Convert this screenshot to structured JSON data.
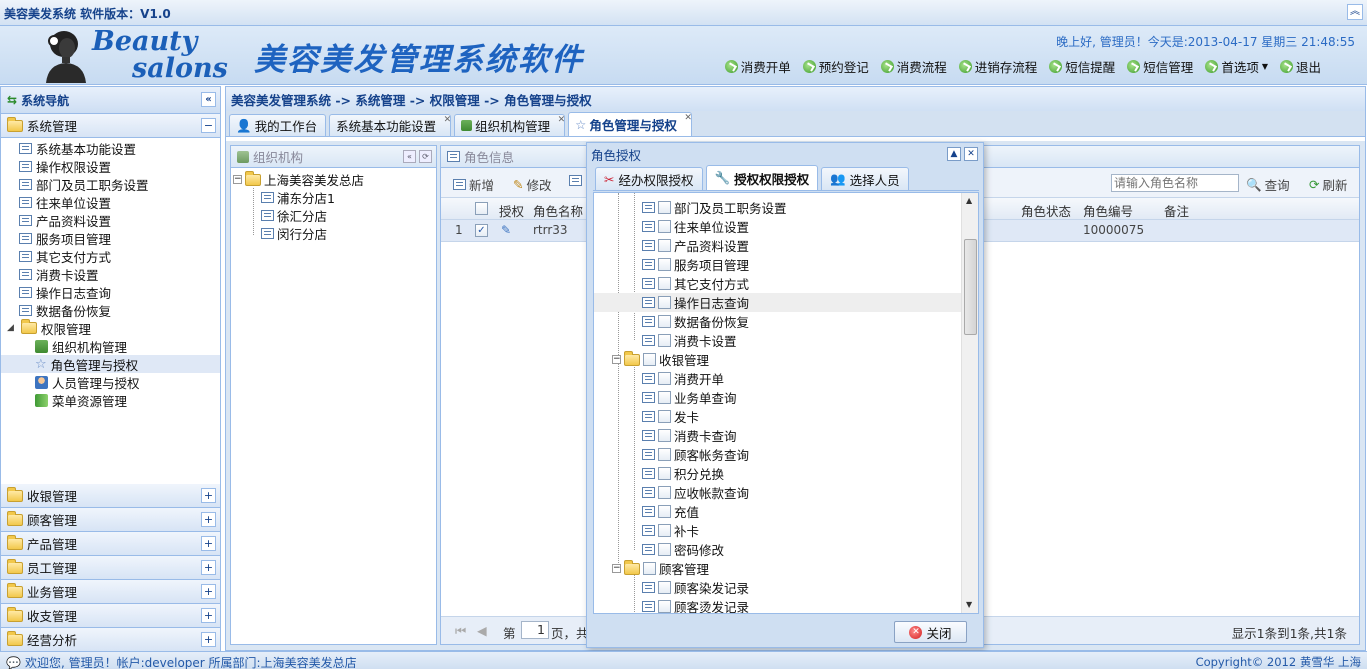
{
  "app": {
    "title": "美容美发系统 软件版本：V1.0",
    "logo_line1": "Beauty",
    "logo_line2": "salons",
    "banner_title": "美容美发管理系统软件"
  },
  "header": {
    "greeting": "晚上好, 管理员！今天是:2013-04-17 星期三 21:48:55",
    "nav": [
      "消费开单",
      "预约登记",
      "消费流程",
      "进销存流程",
      "短信提醒",
      "短信管理",
      "首选项",
      "退出"
    ],
    "nav_icon": "green-refresh-icon"
  },
  "sidebar": {
    "title": "系统导航",
    "open_section": "系统管理",
    "items": [
      "系统基本功能设置",
      "操作权限设置",
      "部门及员工职务设置",
      "往来单位设置",
      "产品资料设置",
      "服务项目管理",
      "其它支付方式",
      "消费卡设置",
      "操作日志查询",
      "数据备份恢复"
    ],
    "sub_section": "权限管理",
    "sub_items": [
      "组织机构管理",
      "角色管理与授权",
      "人员管理与授权",
      "菜单资源管理"
    ],
    "sections": [
      "收银管理",
      "顾客管理",
      "产品管理",
      "员工管理",
      "业务管理",
      "收支管理",
      "经营分析"
    ]
  },
  "breadcrumb": "美容美发管理系统 -> 系统管理 -> 权限管理 -> 角色管理与授权",
  "tabs": [
    "我的工作台",
    "系统基本功能设置",
    "组织机构管理",
    "角色管理与授权"
  ],
  "org_panel": {
    "title": "组织机构",
    "root": "上海美容美发总店",
    "children": [
      "浦东分店1",
      "徐汇分店",
      "闵行分店"
    ]
  },
  "role_panel": {
    "title": "角色信息",
    "toolbar": {
      "add": "新增",
      "edit": "修改",
      "search_placeholder": "请输入角色名称",
      "search": "查询",
      "refresh": "刷新"
    },
    "columns": [
      "授权",
      "角色名称",
      "角色状态",
      "角色编号",
      "备注"
    ],
    "row": {
      "index": "1",
      "name": "rtrr33",
      "code": "10000075"
    },
    "pager": {
      "page_label": "第",
      "page": "1",
      "page_suffix": "页，共",
      "summary": "显示1条到1条,共1条"
    }
  },
  "dialog": {
    "title": "角色授权",
    "tabs": [
      "经办权限授权",
      "授权权限授权",
      "选择人员"
    ],
    "group1_items": [
      "部门及员工职务设置",
      "往来单位设置",
      "产品资料设置",
      "服务项目管理",
      "其它支付方式",
      "操作日志查询",
      "数据备份恢复",
      "消费卡设置"
    ],
    "group2": "收银管理",
    "group2_items": [
      "消费开单",
      "业务单查询",
      "发卡",
      "消费卡查询",
      "顾客帐务查询",
      "积分兑换",
      "应收帐款查询",
      "充值",
      "补卡",
      "密码修改"
    ],
    "group3": "顾客管理",
    "group3_items": [
      "顾客染发记录",
      "顾客烫发记录"
    ],
    "close": "关闭"
  },
  "status": {
    "left": "欢迎您, 管理员！帐户:developer 所属部门:上海美容美发总店",
    "right": "Copyright© 2012 黄雪华 上海"
  }
}
